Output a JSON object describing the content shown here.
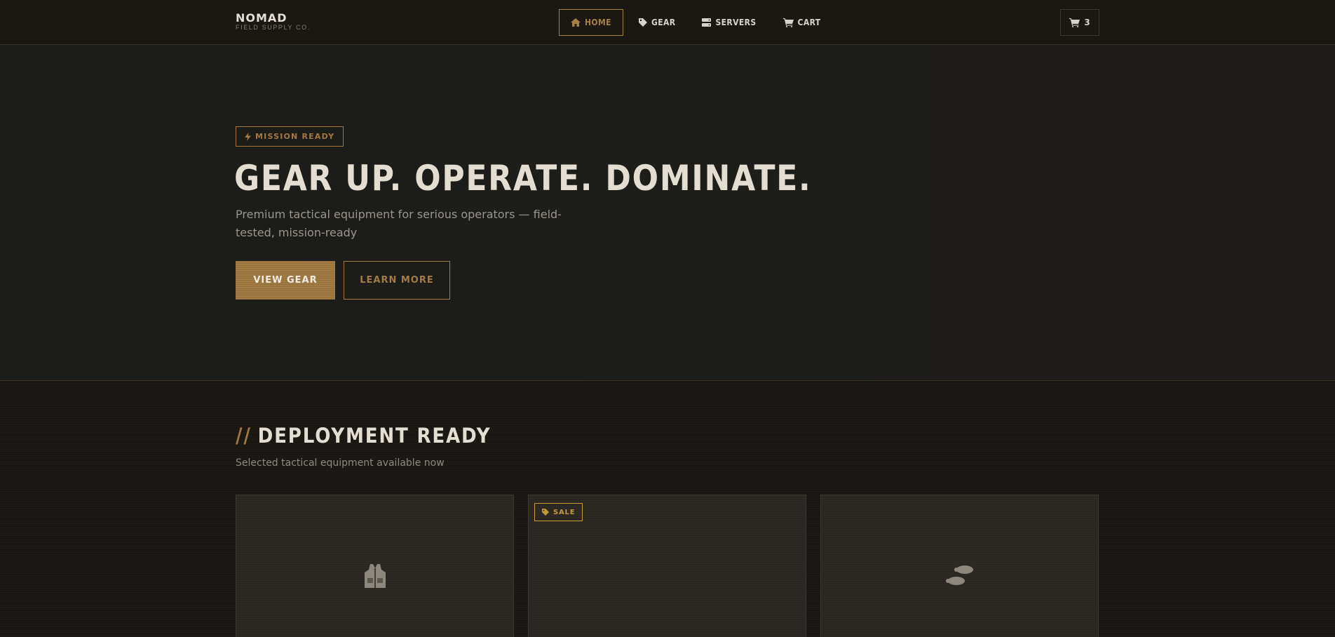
{
  "brand": {
    "name": "NOMAD",
    "tagline": "FIELD SUPPLY CO."
  },
  "nav": {
    "items": [
      {
        "label": "HOME",
        "icon": "home-icon",
        "active": true
      },
      {
        "label": "GEAR",
        "icon": "tag-icon",
        "active": false
      },
      {
        "label": "SERVERS",
        "icon": "server-icon",
        "active": false
      },
      {
        "label": "CART",
        "icon": "cart-icon",
        "active": false
      }
    ],
    "cart_count": "3"
  },
  "hero": {
    "badge": "MISSION READY",
    "title": "GEAR UP. OPERATE. DOMINATE.",
    "subtitle": "Premium tactical equipment for serious operators — field-tested, mission-ready",
    "primary_cta": "VIEW GEAR",
    "secondary_cta": "LEARN MORE"
  },
  "section": {
    "prefix": "//",
    "title": "DEPLOYMENT READY",
    "subtitle": "Selected tactical equipment available now"
  },
  "products": [
    {
      "icon": "vest-icon",
      "tag": ""
    },
    {
      "icon": "",
      "tag": "SALE"
    },
    {
      "icon": "boots-icon",
      "tag": ""
    }
  ],
  "colors": {
    "accent": "#a17a44",
    "sale": "#c19a3c",
    "background": "#1a1713",
    "text": "#d8d2c8"
  }
}
